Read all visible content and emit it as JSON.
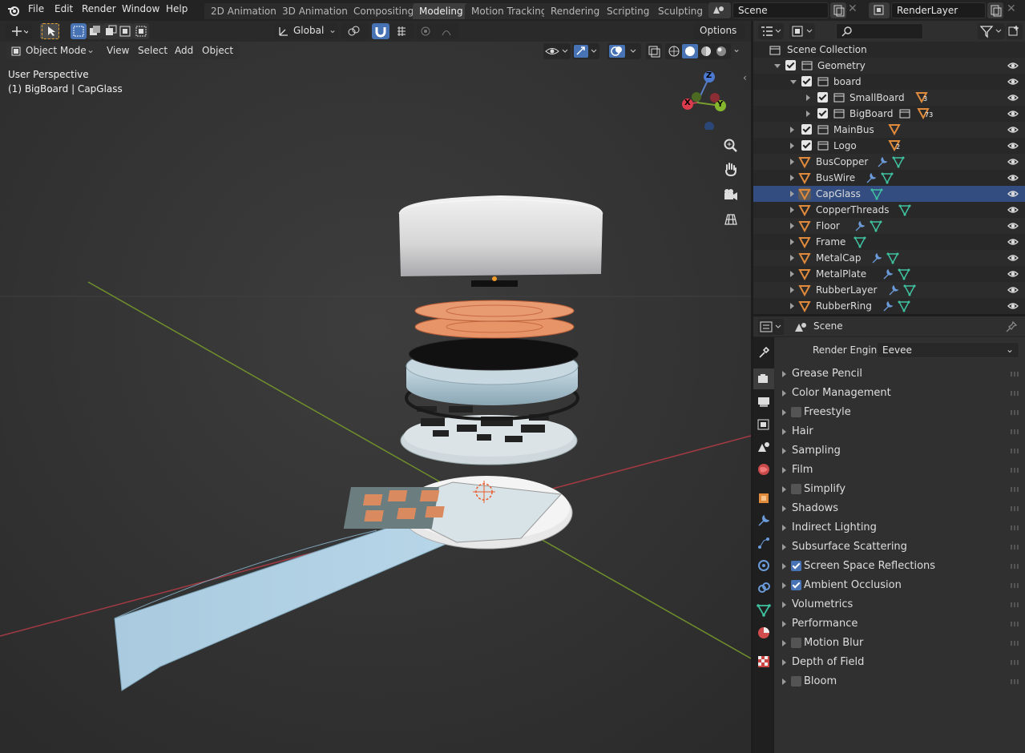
{
  "topbar": {
    "menus": [
      "File",
      "Edit",
      "Render",
      "Window",
      "Help"
    ],
    "workspaces": [
      "2D Animation",
      "3D Animation",
      "Compositing",
      "Modeling",
      "Motion Tracking",
      "Rendering",
      "Scripting",
      "Sculpting"
    ],
    "active_workspace": "Modeling",
    "scene": "Scene",
    "view_layer": "RenderLayer"
  },
  "viewport_header": {
    "orientation": "Global",
    "options": "Options",
    "mode": "Object Mode",
    "menus": [
      "View",
      "Select",
      "Add",
      "Object"
    ]
  },
  "viewport": {
    "perspective": "User Perspective",
    "active_object": "(1) BigBoard | CapGlass",
    "gizmo": {
      "x": "X",
      "y": "Y",
      "z": "Z"
    }
  },
  "outliner": {
    "root": "Scene Collection",
    "rows": [
      {
        "label": "Geometry",
        "kind": "collection",
        "expanded": true
      },
      {
        "label": "board",
        "kind": "collection",
        "expanded": true
      },
      {
        "label": "SmallBoard",
        "kind": "collection",
        "badge": "3"
      },
      {
        "label": "BigBoard",
        "kind": "collection",
        "badge": "73"
      },
      {
        "label": "MainBus",
        "kind": "collection"
      },
      {
        "label": "Logo",
        "kind": "collection",
        "badge": "2"
      },
      {
        "label": "BusCopper",
        "kind": "object"
      },
      {
        "label": "BusWire",
        "kind": "object"
      },
      {
        "label": "CapGlass",
        "kind": "object",
        "selected": true
      },
      {
        "label": "CopperThreads",
        "kind": "object"
      },
      {
        "label": "Floor",
        "kind": "object"
      },
      {
        "label": "Frame",
        "kind": "object"
      },
      {
        "label": "MetalCap",
        "kind": "object"
      },
      {
        "label": "MetalPlate",
        "kind": "object"
      },
      {
        "label": "RubberLayer",
        "kind": "object"
      },
      {
        "label": "RubberRing",
        "kind": "object"
      }
    ]
  },
  "properties": {
    "context": "Scene",
    "render_engine_label": "Render Engine",
    "render_engine": "Eevee",
    "panels": [
      {
        "label": "Grease Pencil"
      },
      {
        "label": "Color Management"
      },
      {
        "label": "Freestyle",
        "checkbox": false
      },
      {
        "label": "Hair"
      },
      {
        "label": "Sampling"
      },
      {
        "label": "Film"
      },
      {
        "label": "Simplify",
        "checkbox": false
      },
      {
        "label": "Shadows"
      },
      {
        "label": "Indirect Lighting"
      },
      {
        "label": "Subsurface Scattering"
      },
      {
        "label": "Screen Space Reflections",
        "checkbox": true
      },
      {
        "label": "Ambient Occlusion",
        "checkbox": true
      },
      {
        "label": "Volumetrics"
      },
      {
        "label": "Performance"
      },
      {
        "label": "Motion Blur",
        "checkbox": false
      },
      {
        "label": "Depth of Field"
      },
      {
        "label": "Bloom",
        "checkbox": false
      }
    ]
  },
  "colors": {
    "accent": "#4772b3",
    "object_orange": "#e08a3c",
    "mesh_green": "#3fc2a0",
    "modifier_blue": "#6b9bd9"
  }
}
